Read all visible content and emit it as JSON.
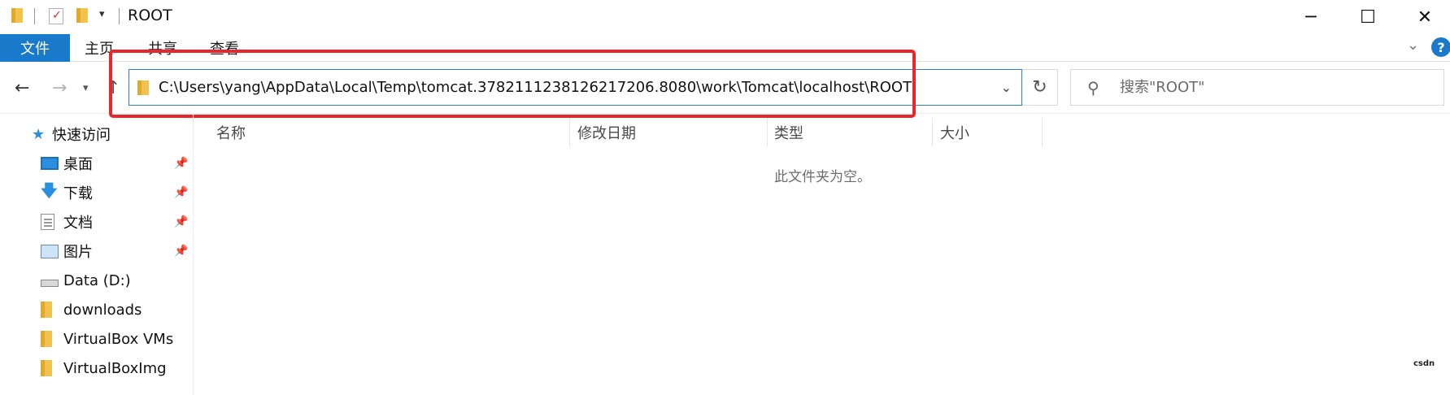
{
  "window": {
    "title": "ROOT",
    "minimize_icon": "minimize-icon",
    "maximize_icon": "maximize-icon",
    "close_icon": "close-icon"
  },
  "quick_access_toolbar": {
    "icons": [
      "folder-icon",
      "properties-icon",
      "new-folder-icon",
      "customize-dropdown-icon"
    ]
  },
  "ribbon": {
    "file_tab": "文件",
    "tabs": [
      "主页",
      "共享",
      "查看"
    ],
    "accent_color": "#1979ca"
  },
  "navigation": {
    "address": "C:\\Users\\yang\\AppData\\Local\\Temp\\tomcat.3782111238126217206.8080\\work\\Tomcat\\localhost\\ROOT",
    "search_placeholder": "搜索\"ROOT\""
  },
  "sidebar": {
    "quick_access": "快速访问",
    "items": [
      {
        "label": "桌面",
        "icon": "desktop-icon",
        "pinned": true
      },
      {
        "label": "下载",
        "icon": "download-icon",
        "pinned": true
      },
      {
        "label": "文档",
        "icon": "document-icon",
        "pinned": true
      },
      {
        "label": "图片",
        "icon": "picture-icon",
        "pinned": true
      },
      {
        "label": "Data (D:)",
        "icon": "drive-icon",
        "pinned": false
      },
      {
        "label": "downloads",
        "icon": "folder-icon",
        "pinned": false
      },
      {
        "label": "VirtualBox VMs",
        "icon": "folder-icon",
        "pinned": false
      },
      {
        "label": "VirtualBoxImg",
        "icon": "folder-icon",
        "pinned": false
      }
    ]
  },
  "columns": {
    "name": "名称",
    "date_modified": "修改日期",
    "type": "类型",
    "size": "大小"
  },
  "content": {
    "empty_message": "此文件夹为空。"
  },
  "annotation": {
    "highlight_color": "#e8262b"
  },
  "watermark": "csdn"
}
